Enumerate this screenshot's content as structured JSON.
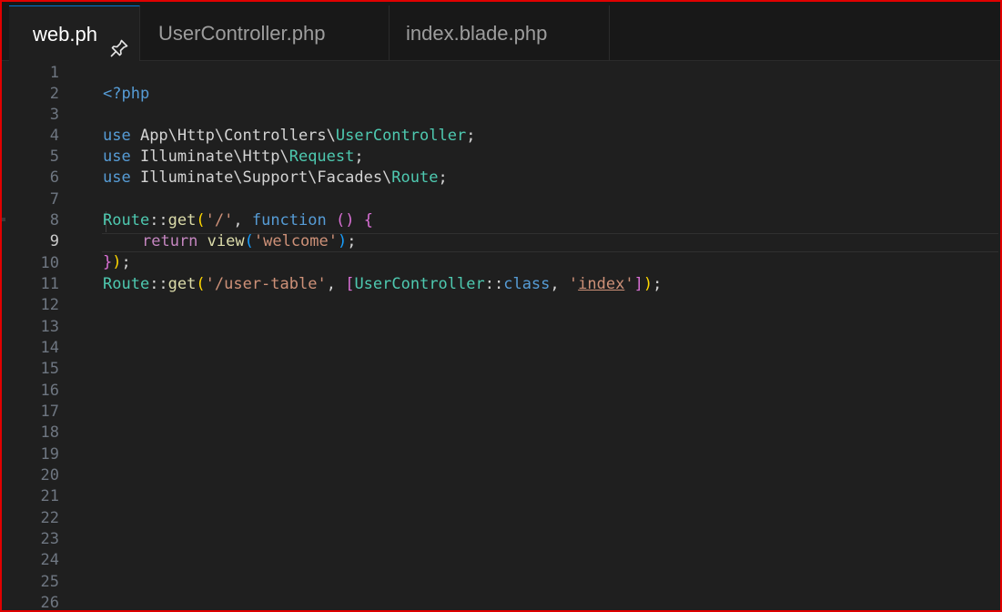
{
  "tabs": [
    {
      "label": "web.ph",
      "active": true,
      "pinned": true
    },
    {
      "label": "UserController.php",
      "active": false
    },
    {
      "label": "index.blade.php",
      "active": false
    }
  ],
  "editor": {
    "language": "php",
    "current_line": 9,
    "line_numbers": [
      "1",
      "2",
      "3",
      "4",
      "5",
      "6",
      "7",
      "8",
      "9",
      "10",
      "11",
      "12",
      "13",
      "14",
      "15",
      "16",
      "17",
      "18",
      "19",
      "20",
      "21",
      "22",
      "23",
      "24",
      "25",
      "26"
    ],
    "code": {
      "l1": [
        "<?php"
      ],
      "l3": [
        "use",
        " App\\Http\\Controllers\\",
        "UserController",
        ";"
      ],
      "l4": [
        "use",
        " Illuminate\\Http\\",
        "Request",
        ";"
      ],
      "l5": [
        "use",
        " Illuminate\\Support\\Facades\\",
        "Route",
        ";"
      ],
      "l7": [
        "Route",
        "::",
        "get",
        "(",
        "'/'",
        ", ",
        "function",
        " ",
        "()",
        " ",
        "{"
      ],
      "l8": [
        "return",
        " ",
        "view",
        "(",
        "'welcome'",
        ")",
        ";"
      ],
      "l9": [
        "}",
        ")",
        ";"
      ],
      "l10": [
        "Route",
        "::",
        "get",
        "(",
        "'/user-table'",
        ", ",
        "[",
        "UserController",
        "::",
        "class",
        ", ",
        "'",
        "index",
        "'",
        "]",
        ")",
        ";"
      ]
    }
  },
  "colors": {
    "keyword": "#569cd6",
    "control": "#c586c0",
    "class": "#4ec9b0",
    "function": "#dcdcaa",
    "string": "#ce9178",
    "frame": "#e00000"
  }
}
